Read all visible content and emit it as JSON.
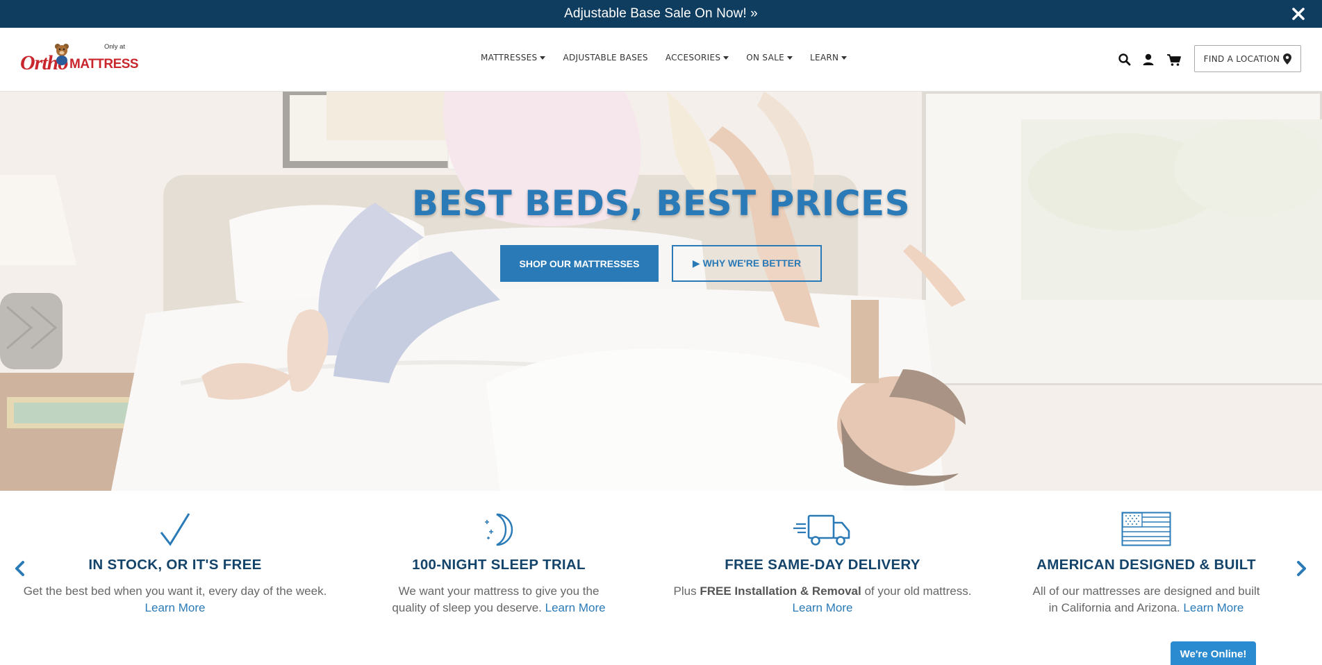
{
  "promo": {
    "text": "Adjustable Base Sale On Now! »",
    "close_icon": "close-icon"
  },
  "logo": {
    "only_at": "Only at",
    "ortho": "Ortho",
    "mattress": "MATTRESS"
  },
  "nav": {
    "items": [
      {
        "label": "MATTRESSES",
        "dropdown": true
      },
      {
        "label": "ADJUSTABLE BASES",
        "dropdown": false
      },
      {
        "label": "ACCESORIES",
        "dropdown": true
      },
      {
        "label": "ON SALE",
        "dropdown": true
      },
      {
        "label": "LEARN",
        "dropdown": true
      }
    ],
    "icons": [
      "search-icon",
      "account-icon",
      "cart-icon"
    ],
    "find_location": "FIND A LOCATION"
  },
  "hero": {
    "title": "BEST BEDS, BEST PRICES",
    "primary_cta": "SHOP OUR MATTRESSES",
    "secondary_cta": "▶ WHY WE'RE BETTER"
  },
  "features": [
    {
      "icon": "checkmark-icon",
      "title": "IN STOCK, OR IT'S FREE",
      "line1": "Get the best bed when you want it, every day of the week.",
      "link": "Learn More"
    },
    {
      "icon": "moon-icon",
      "title": "100-NIGHT SLEEP TRIAL",
      "line1": "We want your mattress to give you the",
      "line2": "quality of sleep you deserve.",
      "link": "Learn More"
    },
    {
      "icon": "truck-icon",
      "title": "FREE SAME-DAY DELIVERY",
      "pre": "Plus ",
      "bold": "FREE Installation & Removal",
      "post": " of your old mattress.",
      "link": "Learn More"
    },
    {
      "icon": "us-flag-icon",
      "title": "AMERICAN DESIGNED & BUILT",
      "line1": "All of our mattresses are designed and built",
      "line2": "in California and Arizona.",
      "link": "Learn More"
    }
  ],
  "chat": {
    "label": "We're Online!"
  },
  "colors": {
    "brand_blue": "#2a7ab7",
    "navy": "#0f3d5f",
    "heading_navy": "#15446b",
    "logo_red": "#c8262c"
  }
}
